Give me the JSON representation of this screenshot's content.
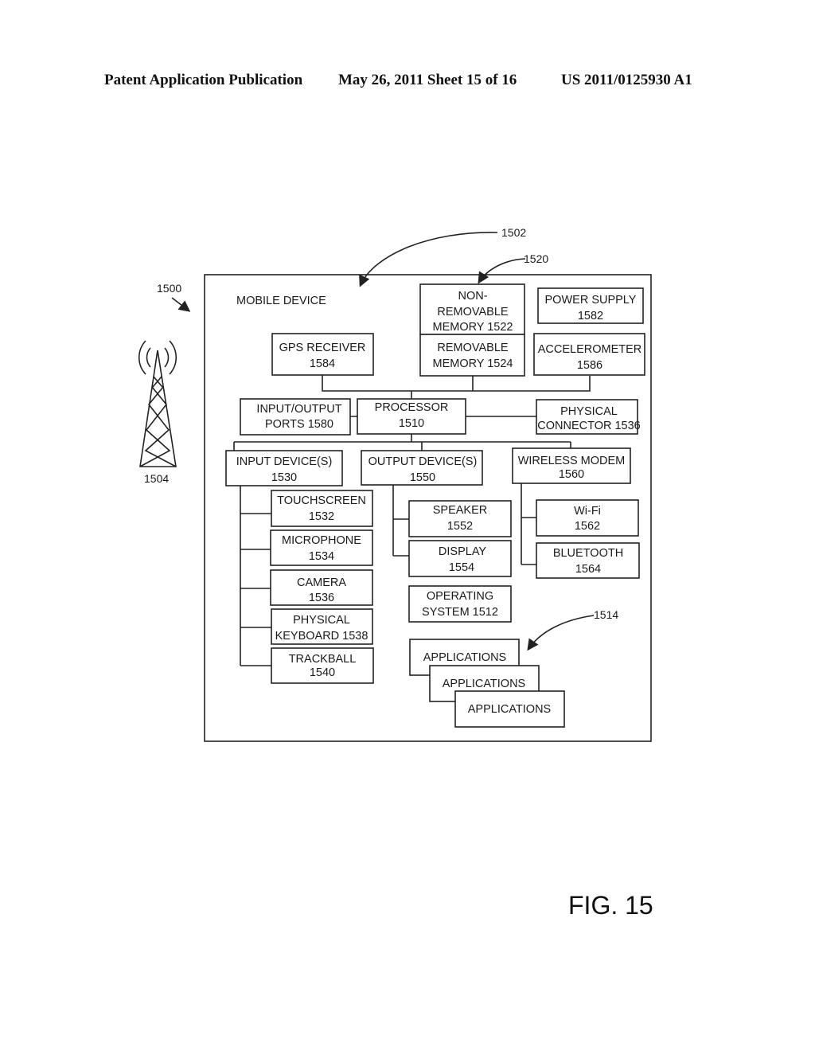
{
  "header": {
    "publication": "Patent Application Publication",
    "date_sheet": "May 26, 2011  Sheet 15 of 16",
    "number": "US 2011/0125930 A1"
  },
  "figure_label": "FIG. 15",
  "refs": {
    "system": "1500",
    "device": "1502",
    "memory": "1520",
    "tower": "1504",
    "apps": "1514"
  },
  "device_title": "MOBILE  DEVICE",
  "boxes": {
    "non_removable_memory": [
      "NON-",
      "REMOVABLE",
      "MEMORY 1522"
    ],
    "removable_memory": [
      "REMOVABLE",
      "MEMORY 1524"
    ],
    "power_supply": [
      "POWER SUPPLY",
      "1582"
    ],
    "gps_receiver": [
      "GPS RECEIVER",
      "1584"
    ],
    "accelerometer": [
      "ACCELEROMETER",
      "1586"
    ],
    "io_ports": [
      "INPUT/OUTPUT",
      "PORTS 1580"
    ],
    "processor": [
      "PROCESSOR",
      "1510"
    ],
    "physical_connector": [
      "PHYSICAL",
      "CONNECTOR 1536"
    ],
    "input_devices": [
      "INPUT DEVICE(S)",
      "1530"
    ],
    "output_devices": [
      "OUTPUT DEVICE(S)",
      "1550"
    ],
    "wireless_modem": [
      "WIRELESS MODEM",
      "1560"
    ],
    "touchscreen": [
      "TOUCHSCREEN",
      "1532"
    ],
    "microphone": [
      "MICROPHONE",
      "1534"
    ],
    "camera": [
      "CAMERA",
      "1536"
    ],
    "physical_keyboard": [
      "PHYSICAL",
      "KEYBOARD 1538"
    ],
    "trackball": [
      "TRACKBALL",
      "1540"
    ],
    "speaker": [
      "SPEAKER",
      "1552"
    ],
    "display": [
      "DISPLAY",
      "1554"
    ],
    "operating_system": [
      "OPERATING",
      "SYSTEM 1512"
    ],
    "wifi": [
      "Wi-Fi",
      "1562"
    ],
    "bluetooth": [
      "BLUETOOTH",
      "1564"
    ],
    "applications_1": [
      "APPLICATIONS"
    ],
    "applications_2": [
      "APPLICATIONS"
    ],
    "applications_3": [
      "APPLICATIONS"
    ]
  }
}
